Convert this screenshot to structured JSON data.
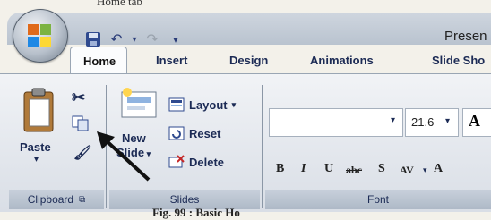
{
  "top_caption": "Home tab",
  "title": "Presen",
  "tabs": [
    "Home",
    "Insert",
    "Design",
    "Animations",
    "Slide Sho"
  ],
  "clipboard": {
    "paste": "Paste",
    "group": "Clipboard"
  },
  "slides": {
    "new_line1": "New",
    "new_line2": "Slide",
    "layout": "Layout",
    "reset": "Reset",
    "delete": "Delete",
    "group": "Slides"
  },
  "font": {
    "size": "21.6",
    "grow": "A",
    "bold": "B",
    "italic": "I",
    "underline": "U",
    "strike": "abc",
    "shadow": "S",
    "spacing": "AV",
    "color": "A",
    "group": "Font"
  },
  "figure_caption": "Fig. 99 : Basic Ho"
}
